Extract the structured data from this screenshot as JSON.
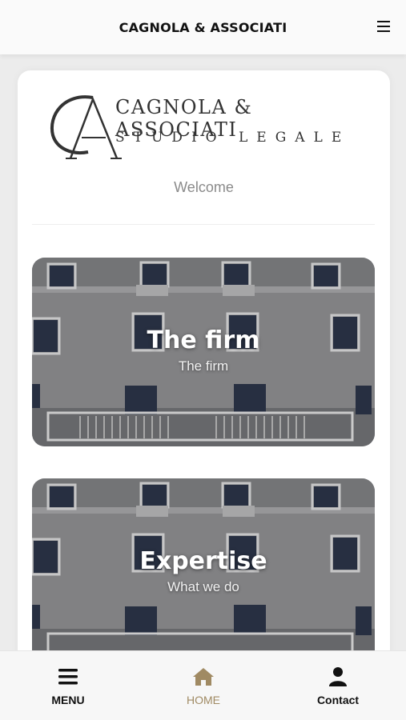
{
  "header": {
    "title": "CAGNOLA & ASSOCIATI",
    "menu_icon": "hamburger-icon"
  },
  "logo": {
    "monogram": "CA",
    "name": "CAGNOLA & ASSOCIATI",
    "subtitle": "STUDIO   LEGALE"
  },
  "welcome": "Welcome",
  "tiles": [
    {
      "title": "The firm",
      "subtitle": "The firm"
    },
    {
      "title": "Expertise",
      "subtitle": "What we do"
    }
  ],
  "bottom_nav": {
    "items": [
      {
        "label": "MENU",
        "icon": "hamburger-icon",
        "active": false
      },
      {
        "label": "HOME",
        "icon": "home-icon",
        "active": true
      },
      {
        "label": "Contact",
        "icon": "user-icon",
        "active": false
      }
    ]
  },
  "colors": {
    "accent": "#a08a63",
    "text": "#111111",
    "muted": "#8a8a8a",
    "background": "#ececec"
  }
}
